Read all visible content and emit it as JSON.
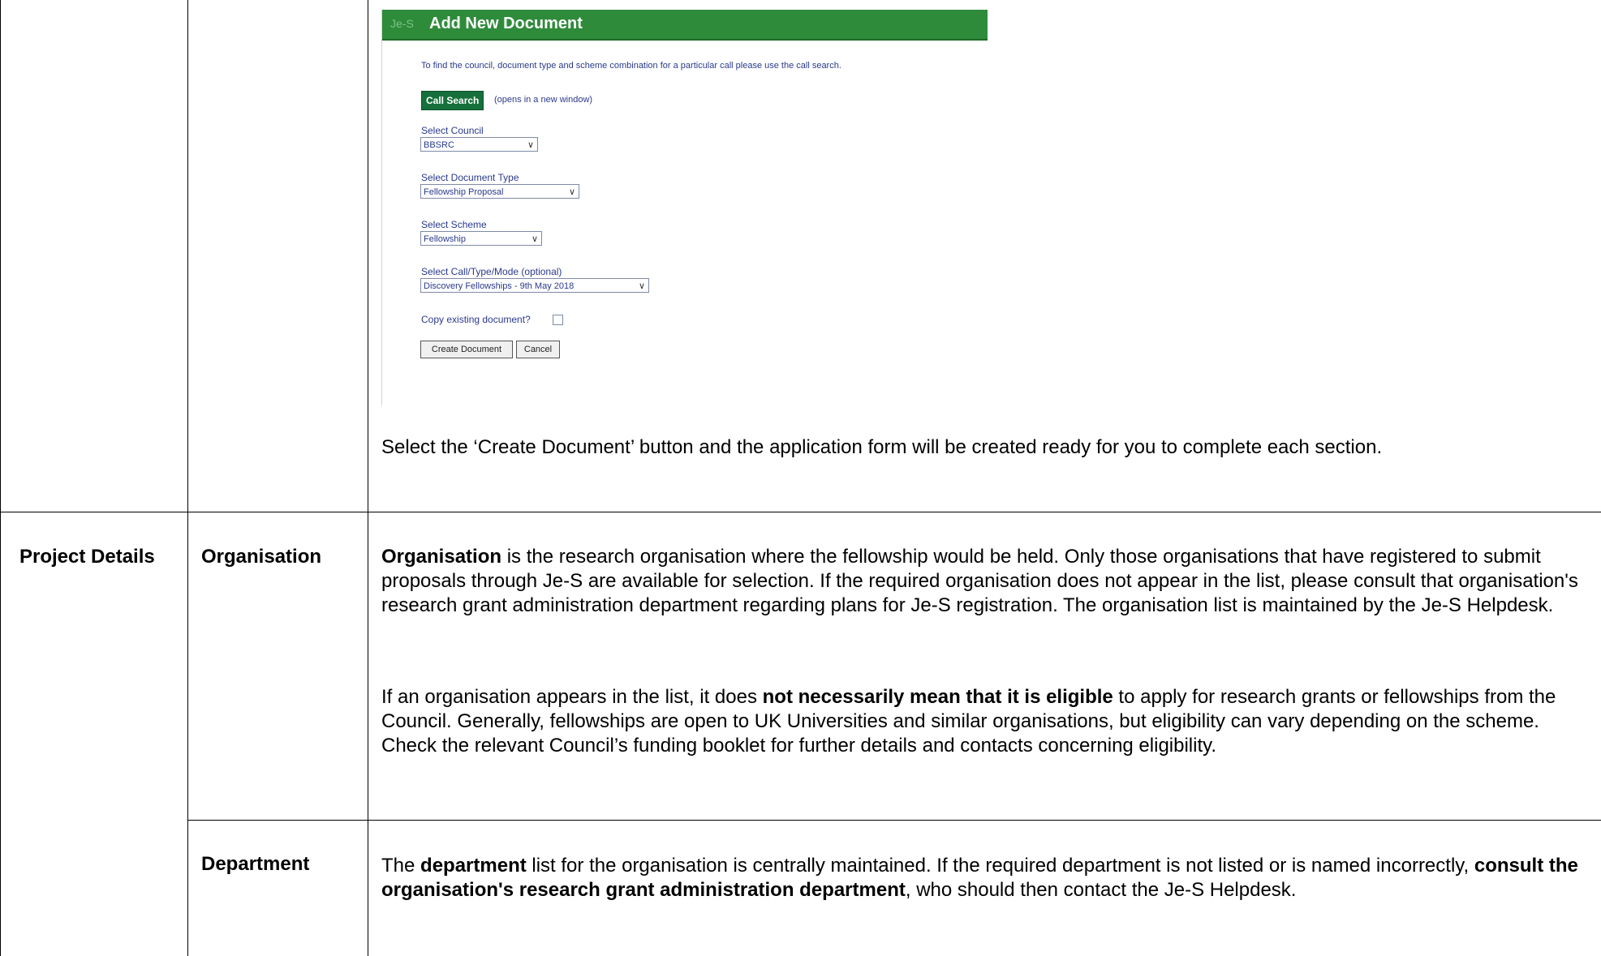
{
  "screenshot": {
    "header_tag": "Je-S",
    "title": "Add New Document",
    "intro": "To find the council, document type and scheme combination for a particular call please use the call search.",
    "call_search_button": "Call Search",
    "call_search_note": "(opens in a new window)",
    "council_label": "Select Council",
    "council_value": "BBSRC",
    "doc_type_label": "Select Document Type",
    "doc_type_value": "Fellowship Proposal",
    "scheme_label": "Select Scheme",
    "scheme_value": "Fellowship",
    "call_label": "Select Call/Type/Mode (optional)",
    "call_value": "Discovery Fellowships - 9th May 2018",
    "copy_label": "Copy existing document?",
    "create_button": "Create Document",
    "cancel_button": "Cancel"
  },
  "create_caption": "Select the ‘Create Document’ button and the application form will be created ready for you to complete each section.",
  "section": {
    "label": "Project Details"
  },
  "organisation": {
    "label": "Organisation",
    "p1_bold": "Organisation",
    "p1_rest": " is the research organisation where the fellowship would be held.  Only those organisations that have registered to submit proposals through Je-S are available for selection.  If the required organisation does not appear in the list, please consult that organisation's research grant administration department regarding plans for Je-S registration.  The organisation list is maintained by the Je-S Helpdesk.",
    "p2_start": "If an organisation appears in the list, it does ",
    "p2_bold": "not necessarily mean that it is eligible",
    "p2_rest": " to apply for research grants or fellowships from the Council.  Generally, fellowships are open to UK Universities and similar organisations, but eligibility can vary depending on the scheme.  Check the relevant Council’s funding booklet for further details and contacts concerning eligibility."
  },
  "department": {
    "label": "Department",
    "t1": "The ",
    "b1": "department",
    "t2": " list for the organisation is centrally maintained. If the required department is not listed or is named incorrectly, ",
    "b2": "consult the organisation's research grant administration department",
    "t3": ", who should then contact the Je-S Helpdesk."
  }
}
